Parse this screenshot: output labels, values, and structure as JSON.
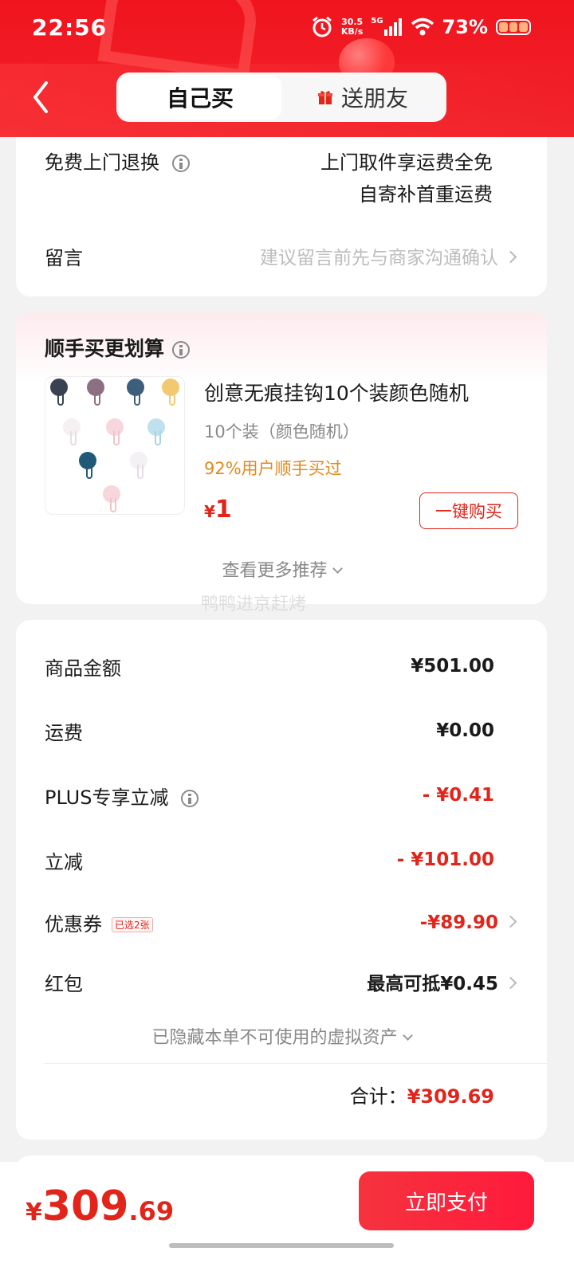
{
  "status_bar": {
    "time": "22:56",
    "net_speed_value": "30.5",
    "net_speed_unit": "KB/s",
    "network_type": "5G",
    "battery_percent": "73%",
    "icons": [
      "alarm-icon",
      "signal-icon",
      "wifi-icon",
      "battery-icon"
    ]
  },
  "header": {
    "tabs": [
      {
        "label": "自己买",
        "active": true
      },
      {
        "label": "送朋友",
        "active": false,
        "icon": "gift-icon"
      }
    ],
    "colors": {
      "header_bg": "#f0141e"
    }
  },
  "service": {
    "return_label": "免费上门退换",
    "return_value_line1": "上门取件享运费全免",
    "return_value_line2": "自寄补首重运费",
    "message_label": "留言",
    "message_placeholder": "建议留言前先与商家沟通确认"
  },
  "recommend": {
    "title": "顺手买更划算",
    "product_name": "创意无痕挂钩10个装颜色随机",
    "product_spec": "10个装（颜色随机）",
    "bought_text": "92%用户顺手买过",
    "price_symbol": "¥",
    "price": "1",
    "buy_button": "一键购买",
    "more_label": "查看更多推荐",
    "watermark": "鸭鸭进京赶烤"
  },
  "summary": {
    "rows": [
      {
        "label": "商品金额",
        "value": "¥501.00"
      },
      {
        "label": "运费",
        "value": "¥0.00"
      },
      {
        "label": "PLUS专享立减",
        "value": "- ¥0.41"
      },
      {
        "label": "立减",
        "value": "- ¥101.00"
      },
      {
        "label": "优惠券",
        "tag": "已选2张",
        "value": "-¥89.90"
      },
      {
        "label": "红包",
        "value": "最高可抵¥0.45"
      }
    ],
    "hidden_assets": "已隐藏本单不可使用的虚拟资产",
    "total_label": "合计：",
    "total_value": "¥309.69"
  },
  "bottom": {
    "yen": "¥",
    "amount_int": "309",
    "amount_dec": ".69",
    "pay_button": "立即支付"
  },
  "colors": {
    "accent": "#e1251b",
    "bought": "#e08a1e"
  }
}
